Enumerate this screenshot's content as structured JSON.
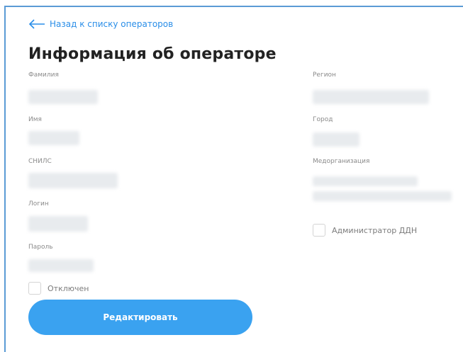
{
  "back_link": {
    "label": "Назад к списку операторов"
  },
  "page_title": "Информация об операторе",
  "left_fields": [
    {
      "label": "Фамилия"
    },
    {
      "label": "Имя"
    },
    {
      "label": "СНИЛС"
    },
    {
      "label": "Логин"
    },
    {
      "label": "Пароль"
    }
  ],
  "right_fields": [
    {
      "label": "Регион"
    },
    {
      "label": "Город"
    },
    {
      "label": "Медорганизация"
    }
  ],
  "checkboxes": {
    "disabled": {
      "label": "Отключен",
      "checked": false
    },
    "admin": {
      "label": "Администратор ДДН",
      "checked": false
    }
  },
  "edit_button": {
    "label": "Редактировать"
  },
  "colors": {
    "accent": "#3aa2f0",
    "link": "#2a8ee8",
    "frame": "#5b9bd5"
  },
  "icons": {
    "back": "arrow-left-icon"
  }
}
